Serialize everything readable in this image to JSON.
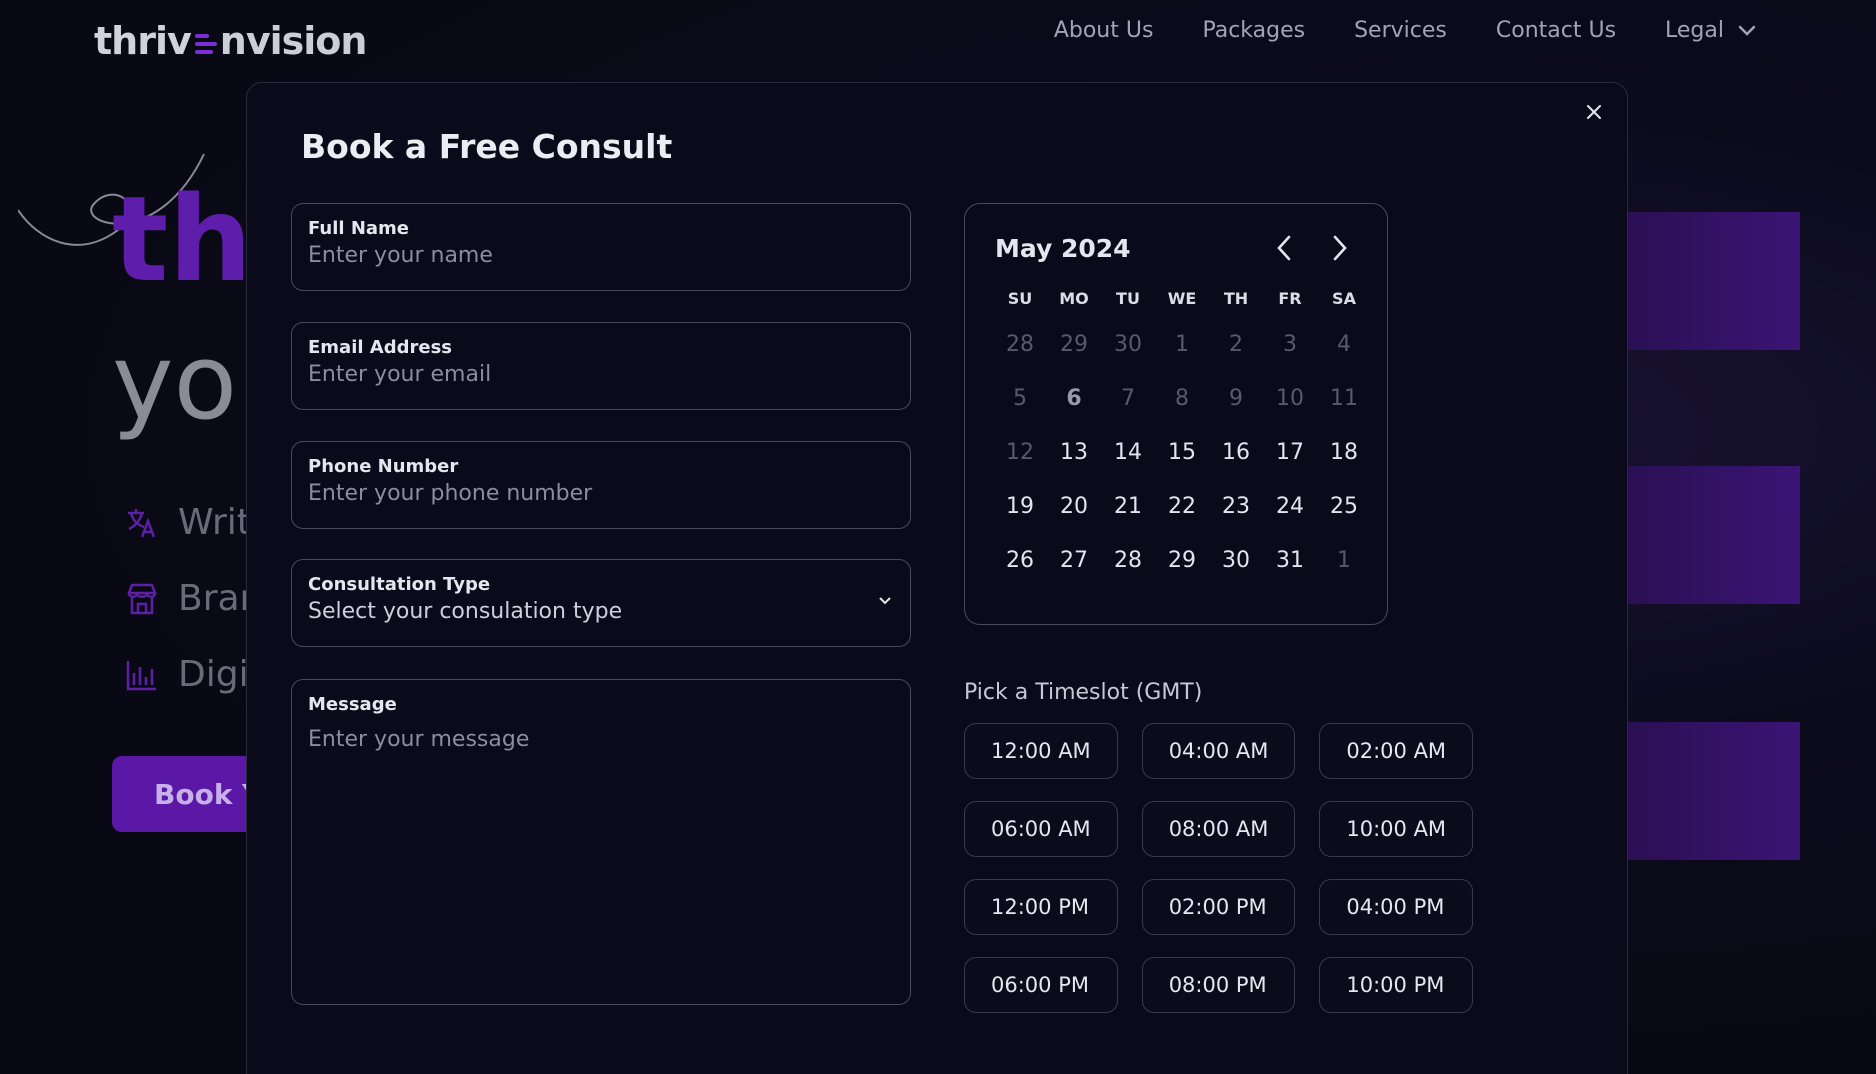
{
  "header": {
    "logo": {
      "part1": "thriv",
      "part2": "nvision"
    },
    "nav": [
      {
        "label": "About Us"
      },
      {
        "label": "Packages"
      },
      {
        "label": "Services"
      },
      {
        "label": "Contact Us"
      }
    ],
    "legal": "Legal"
  },
  "background": {
    "hero_word": "thi",
    "hero_line2": "yo",
    "features": [
      "Writi",
      "Brar",
      "Digit"
    ],
    "cta": "Book Yo"
  },
  "modal": {
    "title": "Book a Free Consult",
    "fields": {
      "name": {
        "label": "Full Name",
        "placeholder": "Enter your name"
      },
      "email": {
        "label": "Email Address",
        "placeholder": "Enter your email"
      },
      "phone": {
        "label": "Phone Number",
        "placeholder": "Enter your phone number"
      },
      "consultation": {
        "label": "Consultation Type",
        "value": "Select your consulation type"
      },
      "message": {
        "label": "Message",
        "placeholder": "Enter your message"
      }
    },
    "calendar": {
      "month": "May 2024",
      "weekdays": [
        "SU",
        "MO",
        "TU",
        "WE",
        "TH",
        "FR",
        "SA"
      ],
      "days": [
        {
          "d": "28",
          "muted": true
        },
        {
          "d": "29",
          "muted": true
        },
        {
          "d": "30",
          "muted": true
        },
        {
          "d": "1",
          "muted": true
        },
        {
          "d": "2",
          "muted": true
        },
        {
          "d": "3",
          "muted": true
        },
        {
          "d": "4",
          "muted": true
        },
        {
          "d": "5",
          "muted": true
        },
        {
          "d": "6",
          "today": true
        },
        {
          "d": "7",
          "muted": true
        },
        {
          "d": "8",
          "muted": true
        },
        {
          "d": "9",
          "muted": true
        },
        {
          "d": "10",
          "muted": true
        },
        {
          "d": "11",
          "muted": true
        },
        {
          "d": "12",
          "muted": true
        },
        {
          "d": "13"
        },
        {
          "d": "14"
        },
        {
          "d": "15"
        },
        {
          "d": "16"
        },
        {
          "d": "17"
        },
        {
          "d": "18"
        },
        {
          "d": "19"
        },
        {
          "d": "20"
        },
        {
          "d": "21"
        },
        {
          "d": "22"
        },
        {
          "d": "23"
        },
        {
          "d": "24"
        },
        {
          "d": "25"
        },
        {
          "d": "26"
        },
        {
          "d": "27"
        },
        {
          "d": "28"
        },
        {
          "d": "29"
        },
        {
          "d": "30"
        },
        {
          "d": "31"
        },
        {
          "d": "1",
          "muted": true
        }
      ]
    },
    "timeslots": {
      "label": "Pick a Timeslot (GMT)",
      "slots": [
        "12:00 AM",
        "04:00 AM",
        "02:00 AM",
        "06:00 AM",
        "08:00 AM",
        "10:00 AM",
        "12:00 PM",
        "02:00 PM",
        "04:00 PM",
        "06:00 PM",
        "08:00 PM",
        "10:00 PM"
      ]
    }
  },
  "colors": {
    "accent": "#5b17a6",
    "background": "#0a0a17",
    "modal": "#0b0a1a",
    "border": "#4a4958"
  }
}
